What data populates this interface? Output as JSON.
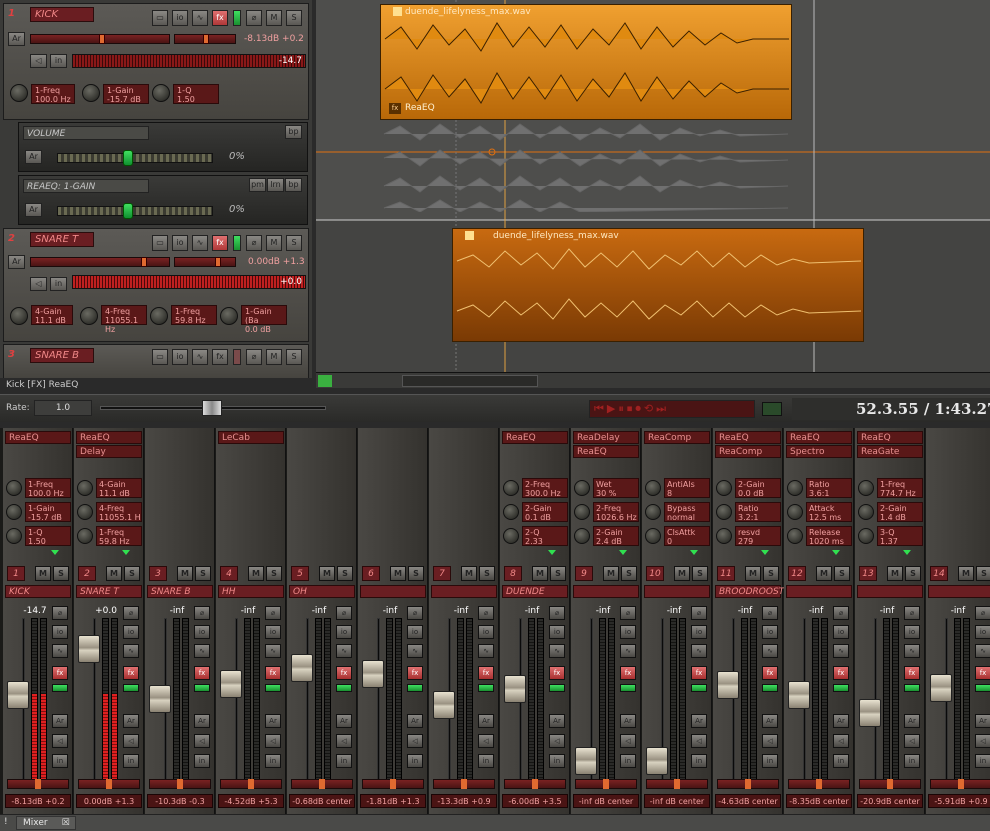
{
  "tracks": [
    {
      "num": "1",
      "name": "KICK",
      "readout": "-8.13dB +0.2",
      "meter": "-14.7",
      "knobs": [
        {
          "label": "1-Freq",
          "value": "100.0 Hz"
        },
        {
          "label": "1-Gain",
          "value": "-15.7 dB"
        },
        {
          "label": "1-Q",
          "value": "1.50"
        }
      ]
    },
    {
      "num": "2",
      "name": "SNARE T",
      "readout": "0.00dB +1.3",
      "meter": "+0.0",
      "knobs": [
        {
          "label": "4-Gain",
          "value": "11.1 dB"
        },
        {
          "label": "4-Freq",
          "value": "11055.1 Hz"
        },
        {
          "label": "1-Freq",
          "value": "59.8 Hz"
        },
        {
          "label": "1-Gain (Ba",
          "value": "0.0 dB"
        }
      ]
    },
    {
      "num": "3",
      "name": "SNARE B"
    }
  ],
  "envelopes": [
    {
      "name": "VOLUME",
      "value": "0%",
      "btn": "bp"
    },
    {
      "name": "REAEQ: 1-GAIN",
      "value": "0%",
      "btns": [
        "pm",
        "lrn",
        "bp"
      ]
    }
  ],
  "tcp_buttons": {
    "io": "io",
    "fx": "fx",
    "m": "M",
    "s": "S",
    "ar": "Ar",
    "in": "in"
  },
  "items": [
    {
      "title": "duende_lifelyness_max.wav",
      "fxlabel": "ReaEQ"
    },
    {
      "title": "duende_lifelyness_max.wav"
    }
  ],
  "status": "Kick [FX] ReaEQ",
  "transport": {
    "rate_label": "Rate:",
    "rate_value": "1.0",
    "time": "52.3.55 / 1:43.27"
  },
  "mixer_buttons": {
    "m": "M",
    "s": "S",
    "io": "io",
    "fx": "fx",
    "ar": "Ar",
    "in": "in"
  },
  "mixer": [
    {
      "num": "1",
      "name": "KICK",
      "peak": "-14.7",
      "fx": [
        "ReaEQ"
      ],
      "knobs": [
        {
          "l": "1-Freq",
          "v": "100.0 Hz"
        },
        {
          "l": "1-Gain",
          "v": "-15.7 dB"
        },
        {
          "l": "1-Q",
          "v": "1.50"
        }
      ],
      "val": "-8.13dB +0.2",
      "fader": 0.55,
      "meterfill": 0.55
    },
    {
      "num": "2",
      "name": "SNARE T",
      "peak": "+0.0",
      "fx": [
        "ReaEQ",
        "Delay"
      ],
      "knobs": [
        {
          "l": "4-Gain",
          "v": "11.1 dB"
        },
        {
          "l": "4-Freq",
          "v": "11055.1 Hz"
        },
        {
          "l": "1-Freq",
          "v": "59.8 Hz"
        }
      ],
      "val": "0.00dB +1.3",
      "fader": 0.88,
      "meterfill": 0.55
    },
    {
      "num": "3",
      "name": "SNARE B",
      "peak": "-inf",
      "fx": [],
      "knobs": [],
      "val": "-10.3dB -0.3",
      "fader": 0.52,
      "meterfill": 0
    },
    {
      "num": "4",
      "name": "HH",
      "peak": "-inf",
      "fx": [
        "LeCab"
      ],
      "knobs": [],
      "val": "-4.52dB +5.3",
      "fader": 0.63,
      "meterfill": 0
    },
    {
      "num": "5",
      "name": "OH",
      "peak": "-inf",
      "fx": [],
      "knobs": [],
      "val": "-0.68dB center",
      "fader": 0.74,
      "meterfill": 0
    },
    {
      "num": "6",
      "name": "",
      "peak": "-inf",
      "fx": [],
      "knobs": [],
      "val": "-1.81dB +1.3",
      "fader": 0.7,
      "meterfill": 0
    },
    {
      "num": "7",
      "name": "",
      "peak": "-inf",
      "fx": [],
      "knobs": [],
      "val": "-13.3dB +0.9",
      "fader": 0.48,
      "meterfill": 0
    },
    {
      "num": "8",
      "name": "DUENDE",
      "peak": "-inf",
      "fx": [
        "ReaEQ"
      ],
      "knobs": [
        {
          "l": "2-Freq",
          "v": "300.0 Hz"
        },
        {
          "l": "2-Gain",
          "v": "0.1 dB"
        },
        {
          "l": "2-Q",
          "v": "2.33"
        }
      ],
      "val": "-6.00dB +3.5",
      "fader": 0.59,
      "meterfill": 0
    },
    {
      "num": "9",
      "name": "",
      "peak": "-inf",
      "fx": [
        "ReaDelay",
        "ReaEQ"
      ],
      "knobs": [
        {
          "l": "Wet",
          "v": "30 %"
        },
        {
          "l": "2-Freq",
          "v": "1026.6 Hz"
        },
        {
          "l": "2-Gain",
          "v": "2.4 dB"
        }
      ],
      "val": "-inf dB center",
      "fader": 0.08,
      "meterfill": 0
    },
    {
      "num": "10",
      "name": "",
      "peak": "-inf",
      "fx": [
        "ReaComp"
      ],
      "knobs": [
        {
          "l": "AntiAls",
          "v": "8"
        },
        {
          "l": "Bypass",
          "v": "normal"
        },
        {
          "l": "ClsAttk",
          "v": "0"
        }
      ],
      "val": "-inf dB center",
      "fader": 0.08,
      "meterfill": 0
    },
    {
      "num": "11",
      "name": "BROODROOST",
      "peak": "-inf",
      "fx": [
        "ReaEQ",
        "ReaComp"
      ],
      "knobs": [
        {
          "l": "2-Gain",
          "v": "0.0 dB"
        },
        {
          "l": "Ratio",
          "v": "3.2:1"
        },
        {
          "l": "resvd",
          "v": "279"
        }
      ],
      "val": "-4.63dB center",
      "fader": 0.62,
      "meterfill": 0
    },
    {
      "num": "12",
      "name": "",
      "peak": "-inf",
      "fx": [
        "ReaEQ",
        "Spectro"
      ],
      "knobs": [
        {
          "l": "Ratio",
          "v": "3.6:1"
        },
        {
          "l": "Attack",
          "v": "12.5 ms"
        },
        {
          "l": "Release",
          "v": "1020 ms"
        }
      ],
      "val": "-8.35dB center",
      "fader": 0.55,
      "meterfill": 0
    },
    {
      "num": "13",
      "name": "",
      "peak": "-inf",
      "fx": [
        "ReaEQ",
        "ReaGate"
      ],
      "knobs": [
        {
          "l": "1-Freq",
          "v": "774.7 Hz"
        },
        {
          "l": "2-Gain",
          "v": "1.4 dB"
        },
        {
          "l": "3-Q",
          "v": "1.37"
        }
      ],
      "val": "-20.9dB center",
      "fader": 0.42,
      "meterfill": 0
    },
    {
      "num": "14",
      "name": "",
      "peak": "-inf",
      "fx": [],
      "knobs": [],
      "val": "-5.91dB +0.9",
      "fader": 0.6,
      "meterfill": 0
    }
  ],
  "bottom_tab": {
    "bang": "!",
    "label": "Mixer",
    "close": "☒"
  }
}
